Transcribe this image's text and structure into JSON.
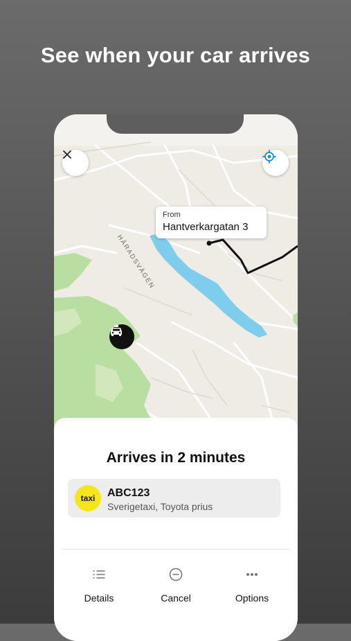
{
  "promo": {
    "title": "See when your car arrives"
  },
  "map": {
    "street_label": "HÄRADSVÄGEN",
    "from_label": "From",
    "from_address": "Hantverkargatan 3",
    "colors": {
      "land": "#eeece4",
      "park": "#b9dea1",
      "water": "#7fcdec",
      "route": "#111111",
      "locate": "#1a8fd6"
    }
  },
  "sheet": {
    "title": "Arrives in 2 minutes",
    "vehicle": {
      "logo_text": "taxi",
      "plate": "ABC123",
      "description": "Sverigetaxi, Toyota prius",
      "logo_color": "#f7e51b"
    },
    "actions": [
      {
        "label": "Details",
        "icon": "list-icon"
      },
      {
        "label": "Cancel",
        "icon": "minus-circle-icon"
      },
      {
        "label": "Options",
        "icon": "more-dots-icon"
      }
    ]
  }
}
